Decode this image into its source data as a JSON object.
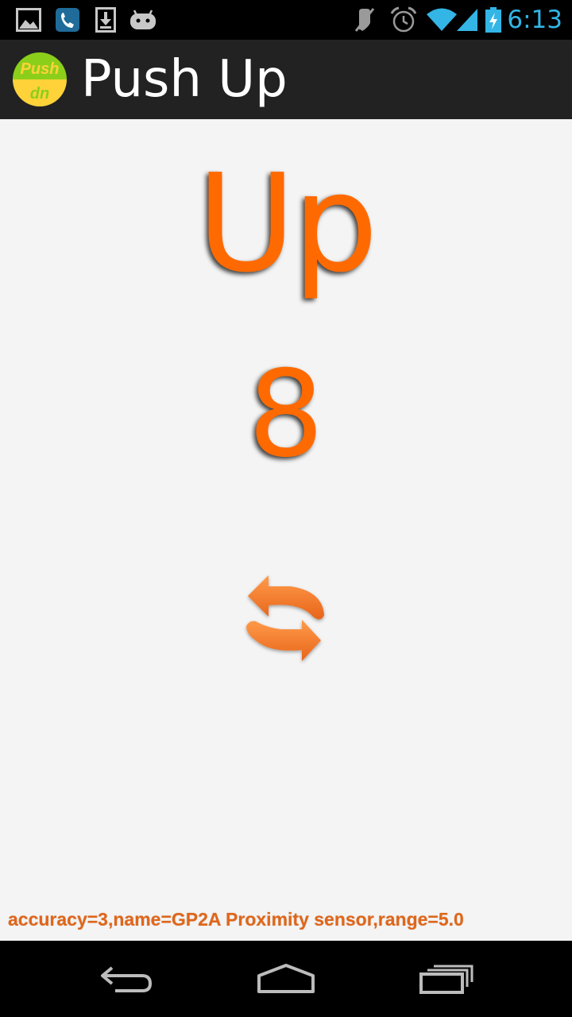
{
  "status_bar": {
    "time": "6:13",
    "time_color": "#33b5e5",
    "left_icons": [
      "gallery-icon",
      "phone-icon",
      "download-icon",
      "android-icon"
    ],
    "right_icons": [
      "mute-icon",
      "alarm-icon",
      "wifi-icon",
      "signal-icon",
      "battery-icon"
    ]
  },
  "action_bar": {
    "title": "Push Up",
    "logo_text_top": "Push",
    "logo_text_bottom": "dn"
  },
  "counter": {
    "state": "Up",
    "count": "8",
    "accent_color": "#ff6a00"
  },
  "reset_button": {
    "icon": "refresh-icon"
  },
  "sensor_info": {
    "text": "accuracy=3,name=GP2A Proximity sensor,range=5.0"
  },
  "nav_bar": {
    "buttons": [
      "back-icon",
      "home-icon",
      "recents-icon"
    ]
  }
}
